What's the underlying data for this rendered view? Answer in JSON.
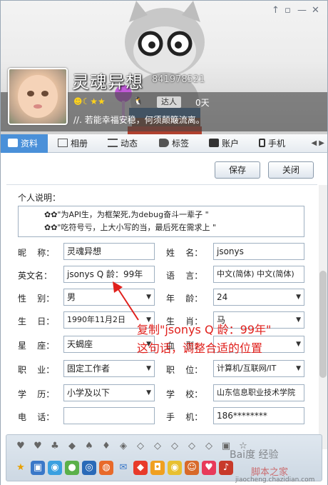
{
  "window_controls": [
    "↑",
    "▫",
    "—",
    "✕"
  ],
  "profile": {
    "nickname": "灵魂异想",
    "qq_number": "841978521",
    "vip_label": "达人",
    "days": "0天",
    "signature": "//. 若能幸福安稳，何须颠簸流离。"
  },
  "tabs": [
    {
      "label": "资料",
      "icon": "profile-card-icon"
    },
    {
      "label": "相册",
      "icon": "photo-album-icon"
    },
    {
      "label": "动态",
      "icon": "feed-icon"
    },
    {
      "label": "标签",
      "icon": "tag-icon"
    },
    {
      "label": "账户",
      "icon": "wallet-icon"
    },
    {
      "label": "手机",
      "icon": "phone-icon"
    }
  ],
  "buttons": {
    "save": "保存",
    "close": "关闭"
  },
  "description": {
    "label": "个人说明：",
    "line1": "✿✿\"为API生，为框架死,为debug奋斗一辈子 \"",
    "line2": "✿✿\"吃符号亏，上大小写的当，最后死在需求上 \""
  },
  "form": {
    "nickname_label": "昵    称：",
    "nickname_value": "灵魂异想",
    "name_label": "姓    名：",
    "name_value": "jsonys",
    "english_label": "英文名：",
    "english_value": "jsonys    Q    龄：99年",
    "language_label": "语    言：",
    "language_value": "中文(简体)  中文(简体)",
    "gender_label": "性    别：",
    "gender_value": "男",
    "age_label": "年    龄：",
    "age_value": "24",
    "birthday_label": "生    日：",
    "birthday_value": "1990年11月2日",
    "zodiac_label": "生    肖：",
    "zodiac_value": "马",
    "constellation_label": "星    座：",
    "constellation_value": "天蝎座",
    "blood_label": "血    型：",
    "blood_value": "",
    "occupation_label": "职    业：",
    "occupation_value": "固定工作者",
    "position_label": "职    位：",
    "position_value": "计算机/互联网/IT",
    "education_label": "学    历：",
    "education_value": "小学及以下",
    "school_label": "学    校：",
    "school_value": "山东信息职业技术学院",
    "phone_label": "电    话：",
    "phone_value": "",
    "mobile_label": "手    机：",
    "mobile_value": "186********"
  },
  "annotation": {
    "line1": "复制\"jsonys    Q    龄：99年\"",
    "line2": "这句话，调整合适的位置"
  },
  "watermark": {
    "line1": "Bai度 经验",
    "line2": "脚本之家",
    "line3": "jiaocheng.chazidian.com"
  },
  "colors": {
    "accent": "#4a90d9",
    "annotation": "#e0201c"
  }
}
